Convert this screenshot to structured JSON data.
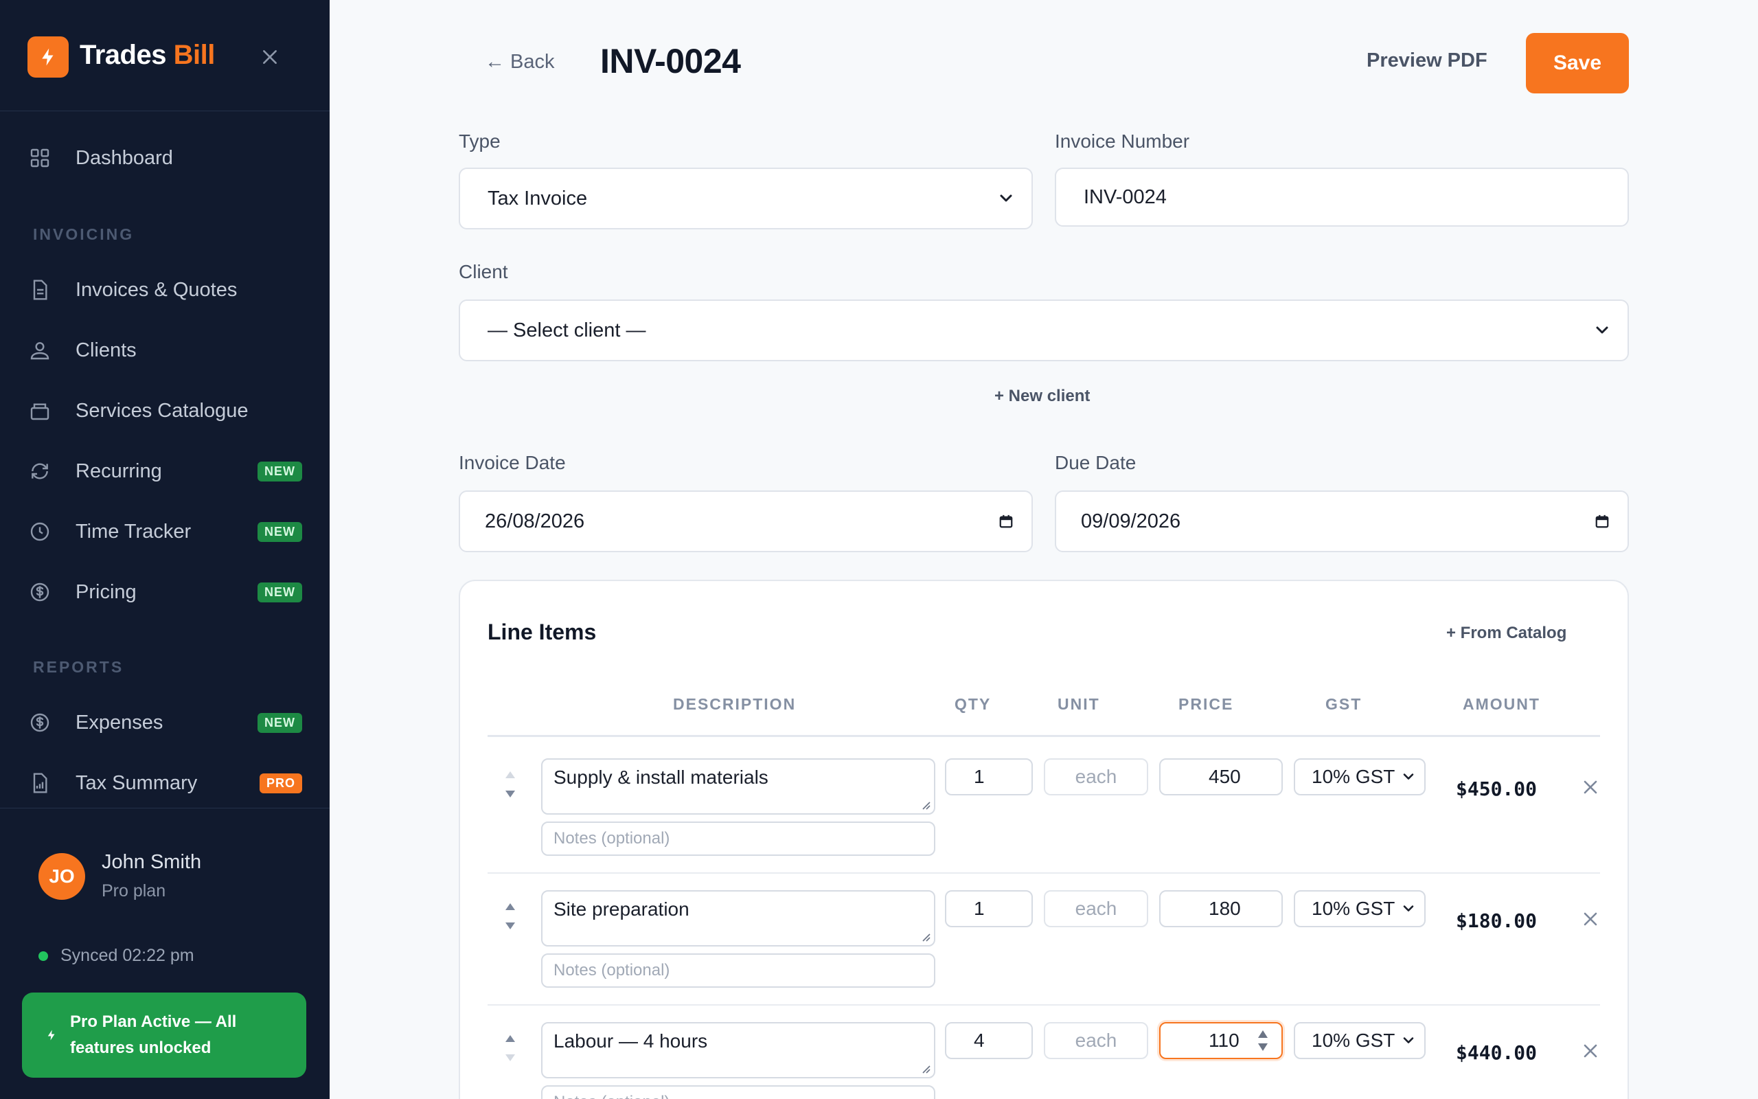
{
  "brand": {
    "name_primary": "Trades",
    "name_accent": "Bill",
    "accent_color": "#f7751f"
  },
  "sidebar": {
    "items": [
      {
        "label": "Dashboard",
        "icon": "grid-icon"
      },
      {
        "label": "Invoices & Quotes",
        "icon": "document-icon"
      },
      {
        "label": "Clients",
        "icon": "users-icon"
      },
      {
        "label": "Services Catalogue",
        "icon": "box-icon"
      },
      {
        "label": "Recurring",
        "icon": "refresh-icon",
        "badge": "NEW"
      },
      {
        "label": "Time Tracker",
        "icon": "clock-icon",
        "badge": "NEW"
      },
      {
        "label": "Pricing",
        "icon": "dollar-icon",
        "badge": "NEW"
      },
      {
        "label": "Expenses",
        "icon": "dollar-icon",
        "badge": "NEW"
      },
      {
        "label": "Tax Summary",
        "icon": "report-icon",
        "badge": "PRO"
      }
    ],
    "sections": {
      "invoicing": "INVOICING",
      "reports": "REPORTS"
    }
  },
  "user": {
    "initials": "JO",
    "name": "John Smith",
    "plan": "Pro plan",
    "sync_status": "Synced 02:22 pm",
    "pro_banner": "Pro Plan Active — All features unlocked"
  },
  "header": {
    "back_label": "← Back",
    "title": "INV-0024",
    "preview_label": "Preview PDF",
    "save_label": "Save"
  },
  "form": {
    "type": {
      "label": "Type",
      "value": "Tax Invoice"
    },
    "invoice_number": {
      "label": "Invoice Number",
      "value": "INV-0024"
    },
    "client": {
      "label": "Client",
      "value": "— Select client —",
      "new_client_label": "+ New client"
    },
    "invoice_date": {
      "label": "Invoice Date",
      "value": "26/08/2026"
    },
    "due_date": {
      "label": "Due Date",
      "value": "09/09/2026"
    }
  },
  "line_items": {
    "title": "Line Items",
    "catalog_label": "+ From Catalog",
    "columns": {
      "description": "DESCRIPTION",
      "qty": "QTY",
      "unit": "UNIT",
      "price": "PRICE",
      "gst": "GST",
      "amount": "AMOUNT"
    },
    "notes_placeholder": "Notes (optional)",
    "rows": [
      {
        "description": "Supply & install materials",
        "qty": "1",
        "unit": "each",
        "price": "450",
        "gst": "10% GST",
        "amount": "$450.00"
      },
      {
        "description": "Site preparation",
        "qty": "1",
        "unit": "each",
        "price": "180",
        "gst": "10% GST",
        "amount": "$180.00"
      },
      {
        "description": "Labour — 4 hours",
        "qty": "4",
        "unit": "each",
        "price": "110",
        "gst": "10% GST",
        "amount": "$440.00"
      }
    ]
  }
}
